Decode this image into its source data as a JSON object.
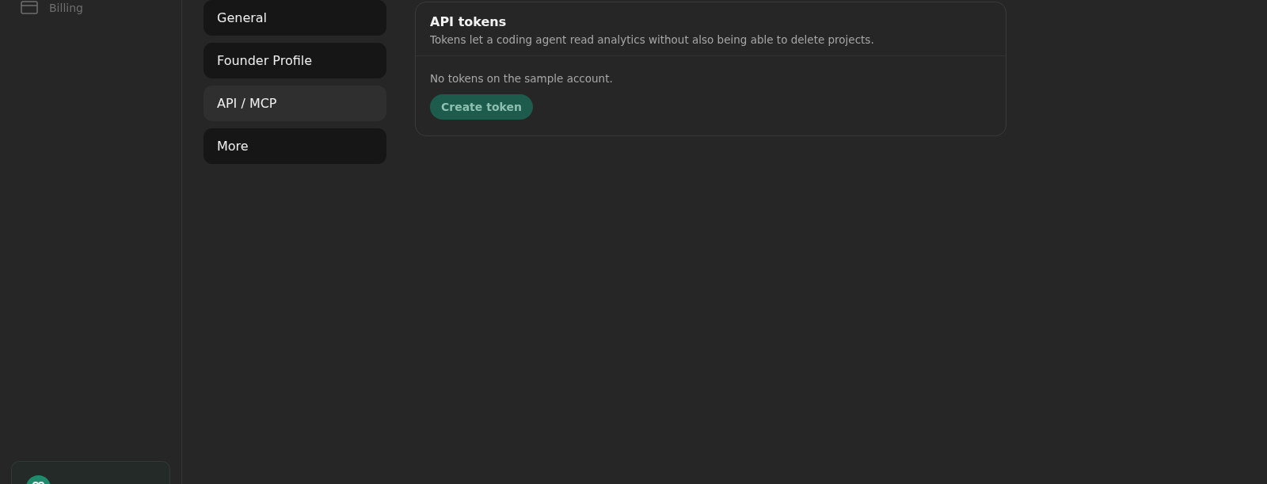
{
  "sidebar": {
    "items": [
      {
        "label": "Billing",
        "selected": false
      }
    ]
  },
  "settings_nav": [
    {
      "label": "General",
      "selected": false
    },
    {
      "label": "Founder Profile",
      "selected": false
    },
    {
      "label": "API / MCP",
      "selected": true
    },
    {
      "label": "More",
      "selected": false
    }
  ],
  "card": {
    "title": "API tokens",
    "description": "Tokens let a coding agent read analytics without also being able to delete projects.",
    "empty_text": "No tokens on the sample account.",
    "button": "Create token"
  }
}
